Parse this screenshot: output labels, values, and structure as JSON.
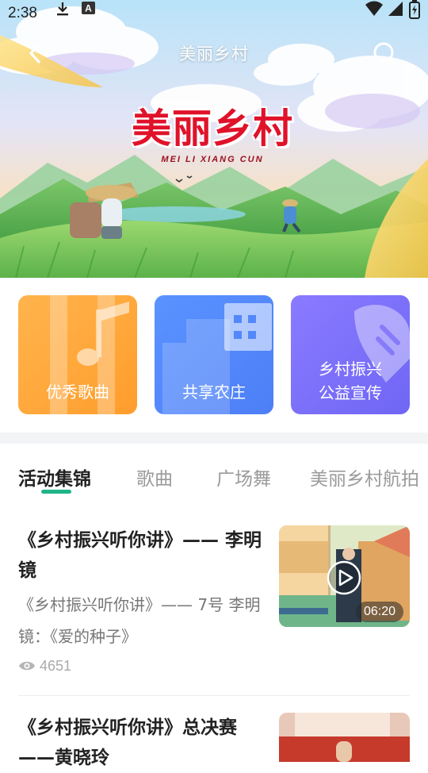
{
  "status_bar": {
    "time": "2:38",
    "icons": [
      "download-icon",
      "keyboard-a-icon",
      "wifi-icon",
      "signal-icon",
      "battery-icon"
    ]
  },
  "header": {
    "title": "美丽乡村",
    "back_icon": "chevron-left-icon",
    "search_icon": "search-icon"
  },
  "banner": {
    "title": "美丽乡村",
    "subtitle": "MEI LI XIANG CUN"
  },
  "categories": [
    {
      "label": "优秀歌曲",
      "icon": "music-note-icon",
      "color": "#ffa63a"
    },
    {
      "label": "共享农庄",
      "icon": "building-icon",
      "color": "#5387fb"
    },
    {
      "label_lines": [
        "乡村振兴",
        "公益宣传"
      ],
      "icon": "hand-icon",
      "color": "#7c70f9"
    }
  ],
  "tabs": [
    {
      "label": "活动集锦",
      "active": true
    },
    {
      "label": "歌曲",
      "active": false
    },
    {
      "label": "广场舞",
      "active": false
    },
    {
      "label": "美丽乡村航拍",
      "active": false
    }
  ],
  "accent_color": "#1fb487",
  "articles": [
    {
      "title": "《乡村振兴听你讲》—— 李明镜",
      "description": "《乡村振兴听你讲》—— 7号 李明镜：《爱的种子》",
      "views": "4651",
      "duration": "06:20"
    },
    {
      "title": "《乡村振兴听你讲》总决赛——黄晓玲"
    }
  ]
}
